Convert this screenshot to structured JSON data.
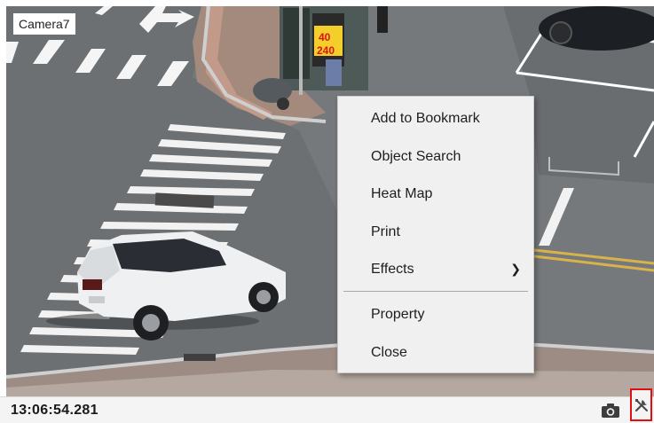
{
  "viewer": {
    "camera_name": "Camera7",
    "timestamp": "13:06:54.281"
  },
  "sign": {
    "line1": "40",
    "line2": "240"
  },
  "context_menu": {
    "items": [
      {
        "label": "Add to Bookmark"
      },
      {
        "label": "Object Search"
      },
      {
        "label": "Heat Map"
      },
      {
        "label": "Print"
      },
      {
        "label": "Effects",
        "has_submenu": true
      },
      {
        "label": "Property"
      },
      {
        "label": "Close"
      }
    ]
  },
  "toolbar": {
    "snapshot_icon": "camera-icon",
    "tools_icon": "tools-icon",
    "tools_highlight_color": "#e01010"
  }
}
